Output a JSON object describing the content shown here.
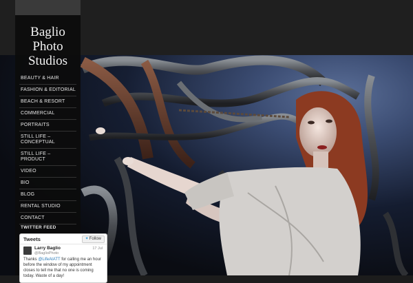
{
  "site": {
    "logo_lines": [
      "Baglio",
      "Photo",
      "Studios"
    ]
  },
  "nav": {
    "items": [
      {
        "label": "Beauty & Hair"
      },
      {
        "label": "Fashion & Editorial"
      },
      {
        "label": "Beach & Resort"
      },
      {
        "label": "Commercial"
      },
      {
        "label": "Portraits"
      },
      {
        "label": "Still Life – Conceptual"
      },
      {
        "label": "Still Life – Product"
      },
      {
        "label": "Video"
      },
      {
        "label": "Bio"
      },
      {
        "label": "Blog"
      },
      {
        "label": "Rental Studio"
      },
      {
        "label": "Contact"
      }
    ]
  },
  "twitter": {
    "section_title": "TWITTER FEED",
    "widget_title": "Tweets",
    "follow_label": "Follow",
    "tweet": {
      "name": "Larry Baglio",
      "handle": "@BaglioPhoto",
      "time": "17 Jul",
      "text_prefix": "Thanks ",
      "mention": "@LifeAtATT",
      "text_rest": " for calling me an hour before the window of my appointment closes to tell me that no one is coming today. Waste of a day!"
    }
  },
  "colors": {
    "background": "#1c1c1c",
    "sidebar": "#0c0c0c",
    "link": "#2b7bb9"
  },
  "icons": {
    "follow": "twitter-bird-icon"
  }
}
